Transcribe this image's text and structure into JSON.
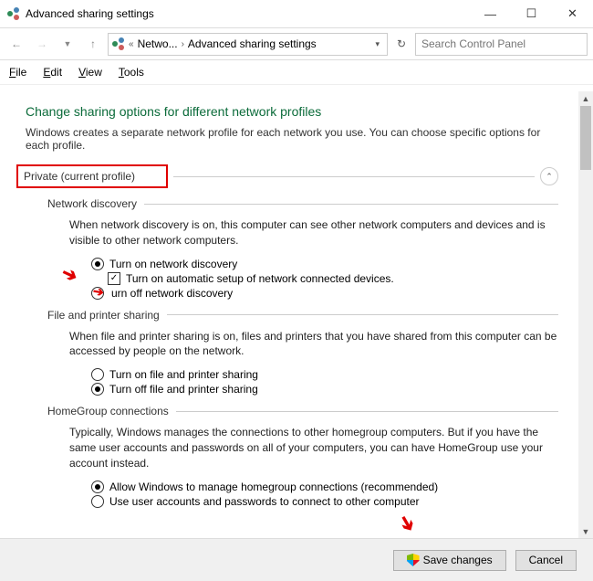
{
  "titlebar": {
    "title": "Advanced sharing settings"
  },
  "breadcrumb": {
    "item1": "Netwo...",
    "item2": "Advanced sharing settings"
  },
  "search": {
    "placeholder": "Search Control Panel"
  },
  "menu": {
    "file": "File",
    "edit": "Edit",
    "view": "View",
    "tools": "Tools"
  },
  "page": {
    "heading": "Change sharing options for different network profiles",
    "intro": "Windows creates a separate network profile for each network you use. You can choose specific options for each profile.",
    "profile": "Private (current profile)"
  },
  "netDisc": {
    "title": "Network discovery",
    "desc": "When network discovery is on, this computer can see other network computers and devices and is visible to other network computers.",
    "on": "Turn on network discovery",
    "auto": "Turn on automatic setup of network connected devices.",
    "off": "urn off network discovery"
  },
  "fps": {
    "title": "File and printer sharing",
    "desc": "When file and printer sharing is on, files and printers that you have shared from this computer can be accessed by people on the network.",
    "on": "Turn on file and printer sharing",
    "off": "Turn off file and printer sharing"
  },
  "hg": {
    "title": "HomeGroup connections",
    "desc": "Typically, Windows manages the connections to other homegroup computers. But if you have the same user accounts and passwords on all of your computers, you can have HomeGroup use your account instead.",
    "allow": "Allow Windows to manage homegroup connections (recommended)",
    "use": "Use user accounts and passwords to connect to other computer"
  },
  "buttons": {
    "save": "Save changes",
    "cancel": "Cancel"
  }
}
